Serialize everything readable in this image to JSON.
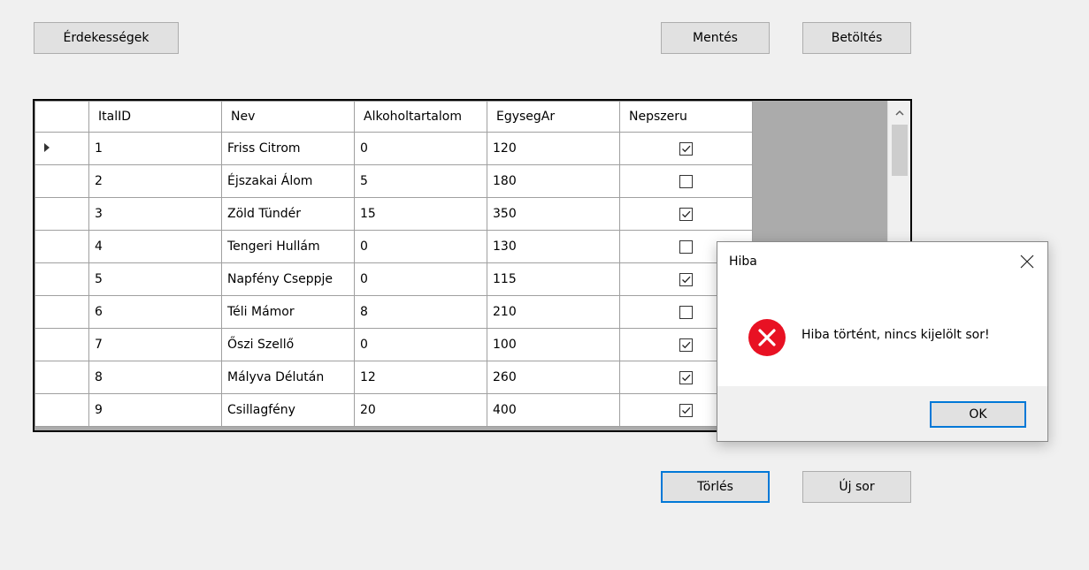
{
  "toolbar": {
    "interests_label": "Érdekességek",
    "save_label": "Mentés",
    "load_label": "Betöltés"
  },
  "grid": {
    "columns": [
      "ItalID",
      "Nev",
      "Alkoholtartalom",
      "EgysegAr",
      "Nepszeru"
    ],
    "rows": [
      {
        "id": "1",
        "nev": "Friss Citrom",
        "alkohol": "0",
        "ar": "120",
        "nepszeru": true,
        "current": true
      },
      {
        "id": "2",
        "nev": "Éjszakai Álom",
        "alkohol": "5",
        "ar": "180",
        "nepszeru": false
      },
      {
        "id": "3",
        "nev": "Zöld Tündér",
        "alkohol": "15",
        "ar": "350",
        "nepszeru": true
      },
      {
        "id": "4",
        "nev": "Tengeri Hullám",
        "alkohol": "0",
        "ar": "130",
        "nepszeru": false
      },
      {
        "id": "5",
        "nev": "Napfény Cseppje",
        "alkohol": "0",
        "ar": "115",
        "nepszeru": true
      },
      {
        "id": "6",
        "nev": "Téli Mámor",
        "alkohol": "8",
        "ar": "210",
        "nepszeru": false
      },
      {
        "id": "7",
        "nev": "Őszi Szellő",
        "alkohol": "0",
        "ar": "100",
        "nepszeru": true
      },
      {
        "id": "8",
        "nev": "Mályva Délután",
        "alkohol": "12",
        "ar": "260",
        "nepszeru": true
      },
      {
        "id": "9",
        "nev": "Csillagfény",
        "alkohol": "20",
        "ar": "400",
        "nepszeru": true
      }
    ]
  },
  "actions": {
    "delete_label": "Törlés",
    "new_row_label": "Új sor"
  },
  "dialog": {
    "title": "Hiba",
    "message": "Hiba történt, nincs kijelölt sor!",
    "ok_label": "OK",
    "icon": "error-icon"
  },
  "colors": {
    "accent": "#0078d7",
    "error": "#e81123"
  }
}
